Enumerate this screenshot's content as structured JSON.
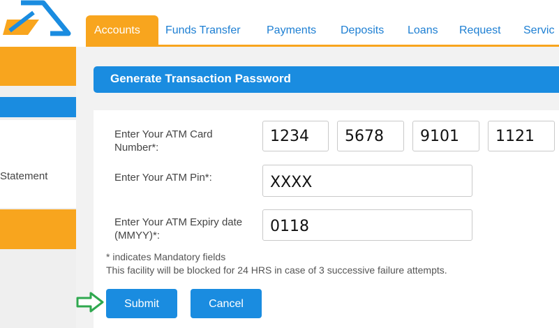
{
  "nav": {
    "tabs": [
      {
        "label": "Accounts",
        "active": true
      },
      {
        "label": "Funds Transfer"
      },
      {
        "label": "Payments"
      },
      {
        "label": "Deposits"
      },
      {
        "label": "Loans"
      },
      {
        "label": "Request"
      },
      {
        "label": "Servic"
      }
    ]
  },
  "sidebar": {
    "statement_label": "Statement"
  },
  "panel": {
    "title": "Generate Transaction Password"
  },
  "form": {
    "atm_card_label": "Enter Your ATM Card Number*:",
    "atm_card_parts": [
      "1234",
      "5678",
      "9101",
      "1121"
    ],
    "atm_pin_label": "Enter Your ATM Pin*:",
    "atm_pin_value": "XXXX",
    "expiry_label": "Enter Your ATM Expiry date (MMYY)*:",
    "expiry_value": "0118",
    "mandatory_note": "* indicates Mandatory fields",
    "block_note": "This facility will be blocked for 24 HRS in case of 3 successive failure attempts."
  },
  "buttons": {
    "submit": "Submit",
    "cancel": "Cancel"
  },
  "colors": {
    "accent_orange": "#f8a51e",
    "primary_blue": "#1a8ce0",
    "arrow_green": "#2fa84f"
  }
}
